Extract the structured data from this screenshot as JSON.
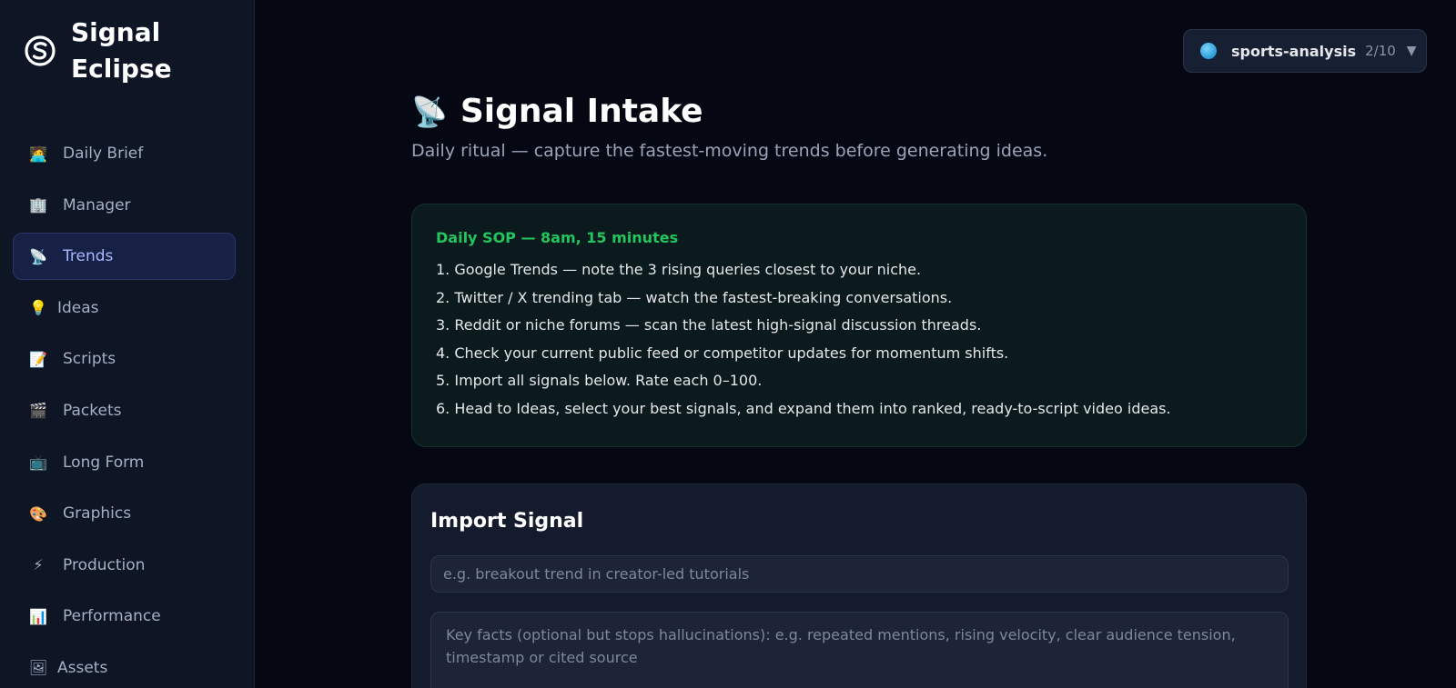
{
  "brand": {
    "name": "Signal Eclipse"
  },
  "sidebar": {
    "items": [
      {
        "icon": "🧑‍💻",
        "icon_name": "person-laptop-icon",
        "label": "Daily Brief",
        "active": false
      },
      {
        "icon": "🏢",
        "icon_name": "office-building-icon",
        "label": "Manager",
        "active": false
      },
      {
        "icon": "📡",
        "icon_name": "satellite-dish-icon",
        "label": "Trends",
        "active": true
      },
      {
        "icon": "💡",
        "icon_name": "lightbulb-icon",
        "label": "Ideas",
        "active": false
      },
      {
        "icon": "📝",
        "icon_name": "memo-icon",
        "label": "Scripts",
        "active": false
      },
      {
        "icon": "🎬",
        "icon_name": "clapperboard-icon",
        "label": "Packets",
        "active": false
      },
      {
        "icon": "📺",
        "icon_name": "television-icon",
        "label": "Long Form",
        "active": false
      },
      {
        "icon": "🎨",
        "icon_name": "palette-icon",
        "label": "Graphics",
        "active": false
      },
      {
        "icon": "⚡",
        "icon_name": "lightning-icon",
        "label": "Production",
        "active": false
      },
      {
        "icon": "📊",
        "icon_name": "bar-chart-icon",
        "label": "Performance",
        "active": false
      },
      {
        "icon": "🖼",
        "icon_name": "picture-frame-icon",
        "label": "Assets",
        "active": false
      }
    ]
  },
  "workspace": {
    "name": "sports-analysis",
    "count": "2/10",
    "chevron": "▼"
  },
  "page": {
    "icon": "📡",
    "title": "Signal Intake",
    "subtitle": "Daily ritual — capture the fastest-moving trends before generating ideas."
  },
  "sop": {
    "title": "Daily SOP — 8am, 15 minutes",
    "steps": [
      "1. Google Trends — note the 3 rising queries closest to your niche.",
      "2. Twitter / X trending tab — watch the fastest-breaking conversations.",
      "3. Reddit or niche forums — scan the latest high-signal discussion threads.",
      "4. Check your current public feed or competitor updates for momentum shifts.",
      "5. Import all signals below. Rate each 0–100.",
      "6. Head to Ideas, select your best signals, and expand them into ranked, ready-to-script video ideas."
    ]
  },
  "import_card": {
    "title": "Import Signal",
    "signal_placeholder": "e.g. breakout trend in creator-led tutorials",
    "facts_placeholder": "Key facts (optional but stops hallucinations): e.g. repeated mentions, rising velocity, clear audience tension, timestamp or cited source"
  },
  "colors": {
    "background": "#050813",
    "sidebar": "#0e1525",
    "accent_active": "#a9b8ff",
    "sop_title": "#22c55e"
  }
}
